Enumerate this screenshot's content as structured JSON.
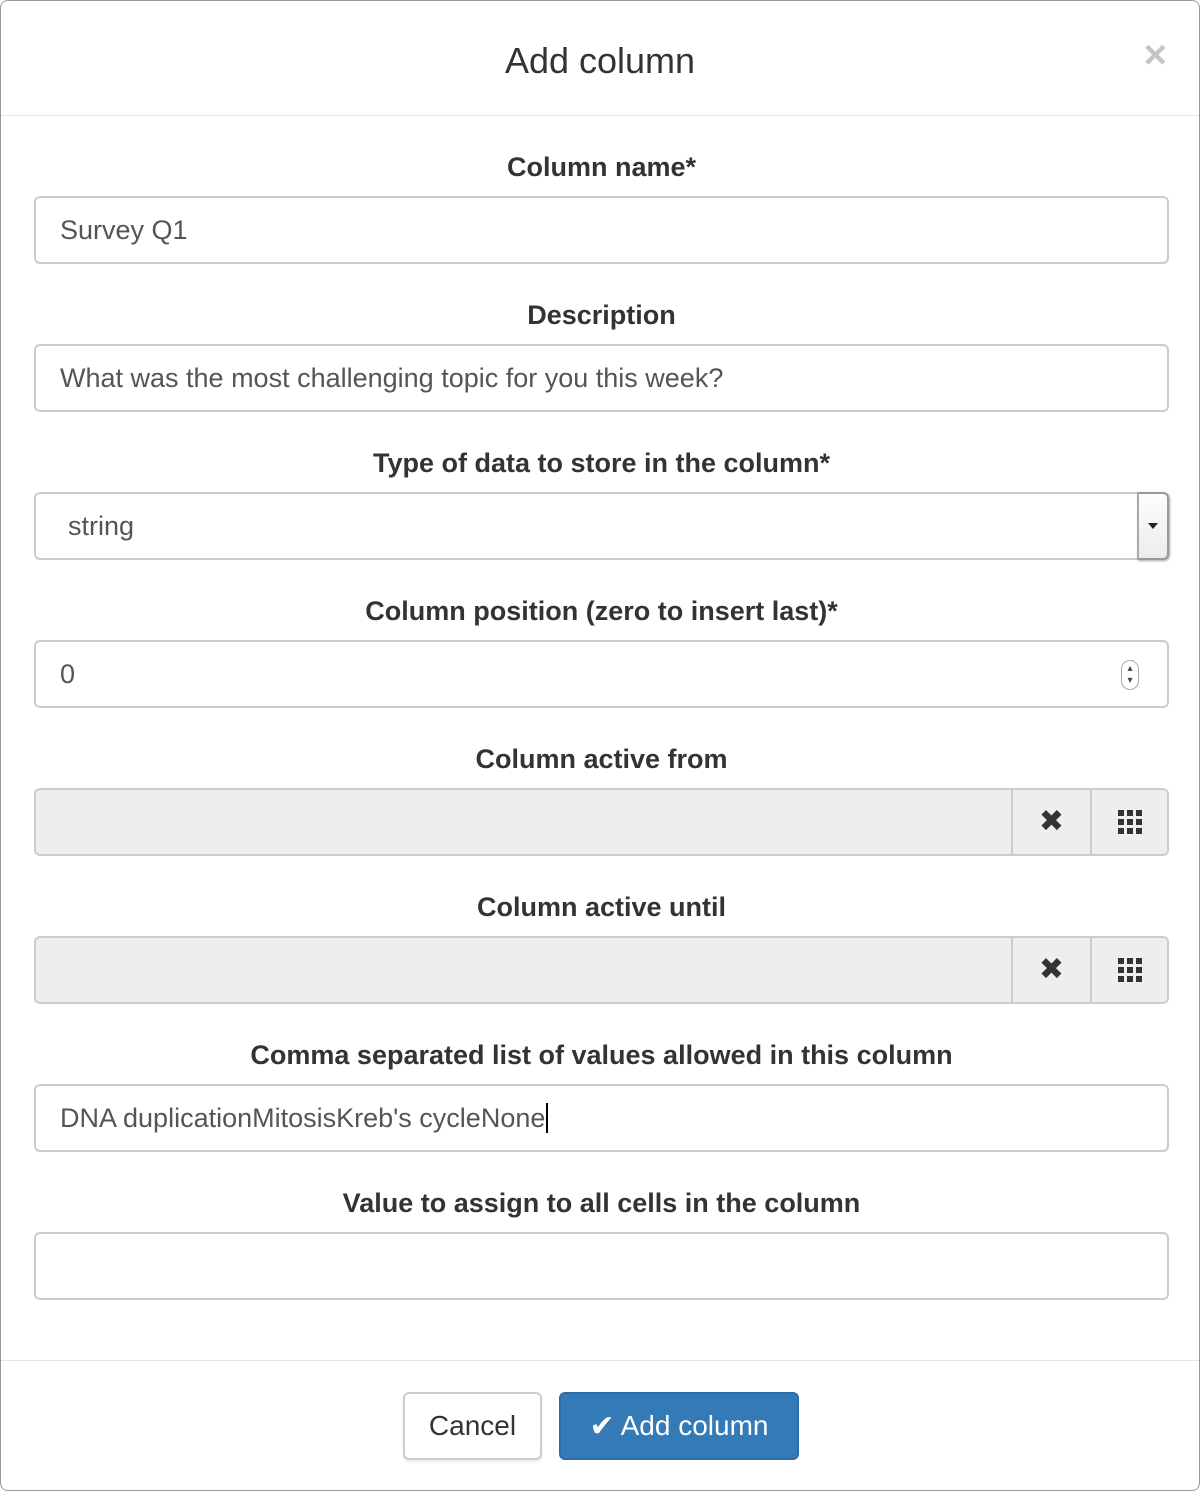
{
  "modal": {
    "title": "Add column",
    "close_label": "×"
  },
  "fields": {
    "column_name": {
      "label": "Column name*",
      "value": "Survey Q1"
    },
    "description": {
      "label": "Description",
      "value": "What was the most challenging topic for you this week?"
    },
    "data_type": {
      "label": "Type of data to store in the column*",
      "value": "string"
    },
    "position": {
      "label": "Column position (zero to insert last)*",
      "value": "0"
    },
    "active_from": {
      "label": "Column active from",
      "value": ""
    },
    "active_until": {
      "label": "Column active until",
      "value": ""
    },
    "allowed_values": {
      "label": "Comma separated list of values allowed in this column",
      "value": "DNA duplicationMitosisKreb's cycleNone"
    },
    "initial_value": {
      "label": "Value to assign to all cells in the column",
      "value": ""
    }
  },
  "footer": {
    "cancel_label": "Cancel",
    "submit_label": "Add column"
  },
  "icons": {
    "clear": "x-icon",
    "calendar": "grid-icon",
    "submit": "check-icon"
  },
  "colors": {
    "primary": "#337ab7",
    "disabled_bg": "#eeeeee",
    "border": "#cccccc"
  }
}
